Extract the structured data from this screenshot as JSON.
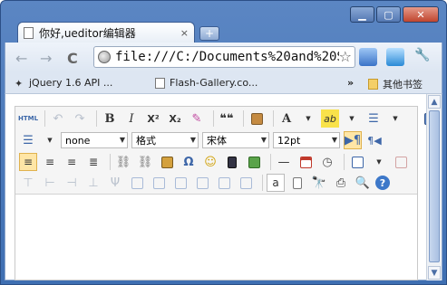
{
  "window": {
    "min_icon": "minimize-icon",
    "max_icon": "maximize-icon",
    "close_icon": "close-icon"
  },
  "tab": {
    "title": "你好,ueditor编辑器",
    "close": "×",
    "new_tab": "+"
  },
  "toolbar": {
    "back": "←",
    "forward": "→",
    "reload": "C",
    "url": "file:///C:/Documents%20and%20S",
    "bookmark_star": "☆"
  },
  "bookmarks": {
    "items": [
      {
        "label": "jQuery 1.6 API ..."
      },
      {
        "label": "Flash-Gallery.co..."
      }
    ],
    "overflow": "»",
    "other": "其他书签"
  },
  "editor": {
    "html_label": "HTML",
    "bold": "B",
    "italic": "I",
    "superscript": "X²",
    "subscript": "X₂",
    "quote": "❝❝",
    "font_color": "A",
    "highlight": "ab",
    "row2": {
      "list_style": "none",
      "paragraph": "格式",
      "font_family": "宋体",
      "font_size": "12pt",
      "omega": "Ω",
      "dash": "—"
    },
    "row4": {
      "anchor": "a"
    }
  },
  "colors": {
    "frame": "#4a77b8",
    "editor_bg": "#f5f5f5",
    "selected_button": "#ffe6a6"
  }
}
